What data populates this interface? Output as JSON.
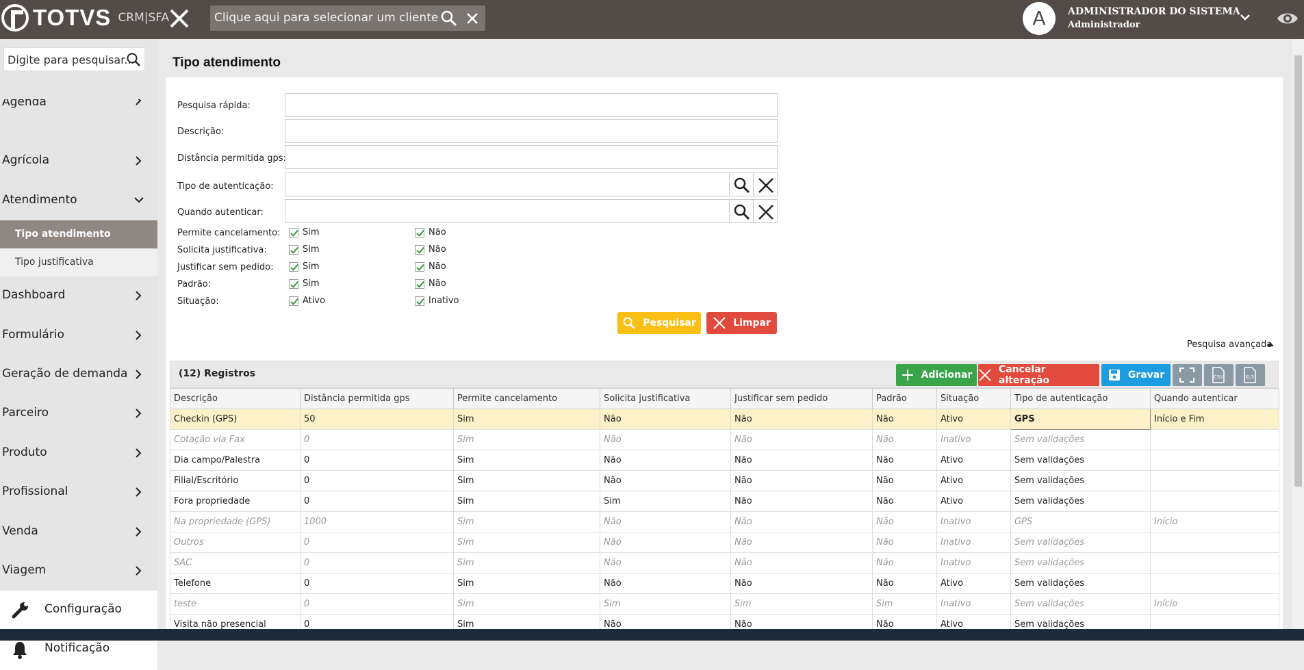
{
  "topbar": {
    "brand": "TOTVS",
    "sub_brand": "CRM|SFA",
    "client_search_placeholder": "Clique aqui para selecionar um cliente",
    "avatar_letter": "A",
    "user_name": "ADMINISTRADOR DO SISTEMA",
    "user_role": "Administrador"
  },
  "sidebar": {
    "search_placeholder": "Digite para pesquisar...",
    "items": [
      {
        "label": "Agenda"
      },
      {
        "label": "Agrícola"
      },
      {
        "label": "Atendimento"
      },
      {
        "label": "Dashboard"
      },
      {
        "label": "Formulário"
      },
      {
        "label": "Geração de demanda"
      },
      {
        "label": "Parceiro"
      },
      {
        "label": "Produto"
      },
      {
        "label": "Profissional"
      },
      {
        "label": "Venda"
      },
      {
        "label": "Viagem"
      }
    ],
    "subitems": [
      {
        "label": "Tipo atendimento"
      },
      {
        "label": "Tipo justificativa"
      }
    ],
    "bottom": [
      {
        "label": "Configuração"
      },
      {
        "label": "Notificação"
      }
    ]
  },
  "page": {
    "title": "Tipo atendimento"
  },
  "filters": {
    "quick_search": "Pesquisa rápida:",
    "description": "Descrição:",
    "gps_distance": "Distância permitida gps:",
    "auth_type": "Tipo de autenticação:",
    "when_auth": "Quando autenticar:",
    "checks": [
      {
        "label": "Permite cancelamento:",
        "opt1": "Sim",
        "opt2": "Não"
      },
      {
        "label": "Solicita justificativa:",
        "opt1": "Sim",
        "opt2": "Não"
      },
      {
        "label": "Justificar sem pedido:",
        "opt1": "Sim",
        "opt2": "Não"
      },
      {
        "label": "Padrão:",
        "opt1": "Sim",
        "opt2": "Não"
      },
      {
        "label": "Situação:",
        "opt1": "Ativo",
        "opt2": "Inativo"
      }
    ],
    "search_button": "Pesquisar",
    "clear_button": "Limpar",
    "advanced_search": "Pesquisa avançada"
  },
  "grid": {
    "record_count": "(12) Registros",
    "add_button": "Adicionar",
    "cancel_button": "Cancelar alteração",
    "save_button": "Gravar",
    "columns": [
      "Descrição",
      "Distância permitida gps",
      "Permite cancelamento",
      "Solicita justificativa",
      "Justificar sem pedido",
      "Padrão",
      "Situação",
      "Tipo de autenticação",
      "Quando autenticar"
    ],
    "rows": [
      [
        "Checkin (GPS)",
        "50",
        "Sim",
        "Não",
        "Não",
        "Não",
        "Ativo",
        "GPS",
        "Início e Fim"
      ],
      [
        "Cotação via Fax",
        "0",
        "Sim",
        "Não",
        "Não",
        "Não",
        "Inativo",
        "Sem validações",
        ""
      ],
      [
        "Dia campo/Palestra",
        "0",
        "Sim",
        "Não",
        "Não",
        "Não",
        "Ativo",
        "Sem validações",
        ""
      ],
      [
        "Filial/Escritório",
        "0",
        "Sim",
        "Não",
        "Não",
        "Não",
        "Ativo",
        "Sem validações",
        ""
      ],
      [
        "Fora propriedade",
        "0",
        "Sim",
        "Sim",
        "Não",
        "Não",
        "Ativo",
        "Sem validações",
        ""
      ],
      [
        "Na propriedade (GPS)",
        "1000",
        "Sim",
        "Não",
        "Não",
        "Não",
        "Inativo",
        "GPS",
        "Início"
      ],
      [
        "Outros",
        "0",
        "Sim",
        "Não",
        "Não",
        "Não",
        "Inativo",
        "Sem validações",
        ""
      ],
      [
        "SAC",
        "0",
        "Sim",
        "Não",
        "Não",
        "Não",
        "Inativo",
        "Sem validações",
        ""
      ],
      [
        "Telefone",
        "0",
        "Sim",
        "Não",
        "Não",
        "Não",
        "Ativo",
        "Sem validações",
        ""
      ],
      [
        "teste",
        "0",
        "Sim",
        "Sim",
        "Sim",
        "Sim",
        "Inativo",
        "Sem validações",
        "Início"
      ],
      [
        "Visita não presencial",
        "0",
        "Sim",
        "Não",
        "Não",
        "Não",
        "Ativo",
        "Sem validações",
        ""
      ]
    ]
  }
}
